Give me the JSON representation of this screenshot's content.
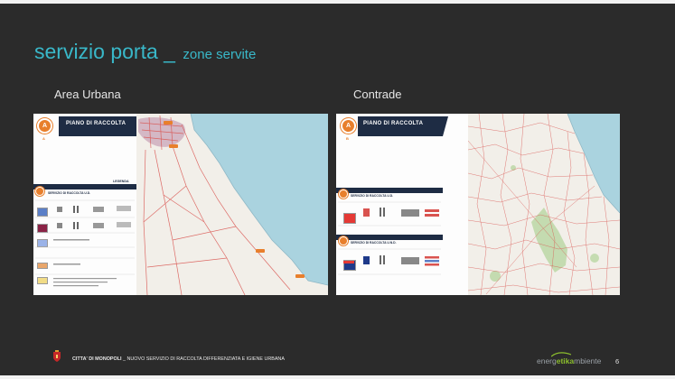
{
  "slide": {
    "title": "servizio porta _",
    "title_suffix": "zone servite",
    "page_number": "6"
  },
  "panels": [
    {
      "label": "Area Urbana",
      "header": "PIANO DI RACCOLTA",
      "badge_letter": "A",
      "badge_sub": "A",
      "legend_title": "LEGENDA",
      "section_title": "SERVIZIO DI RACCOLTA U.D."
    },
    {
      "label": "Contrade",
      "header": "PIANO DI RACCOLTA",
      "badge_letter": "A",
      "badge_sub": "B",
      "section_title_1": "SERVIZIO DI RACCOLTA U.D.",
      "section_title_2": "SERVIZIO DI RACCOLTA U.N.D."
    }
  ],
  "footer": {
    "city": "CITTA' DI MONOPOLI",
    "text": " _ NUOVO SERVIZIO DI RACCOLTA DIFFERENZIATA E IGIENE URBANA",
    "brand_part1": "energ",
    "brand_part2": "etika",
    "brand_part3": "mbiente"
  },
  "colors": {
    "background": "#2b2b2b",
    "title": "#39b8c9",
    "header_navy": "#1e2c44",
    "accent_orange": "#e87f2c",
    "sea": "#aad3df",
    "land": "#f2efe9",
    "route_red": "#d9534f"
  }
}
